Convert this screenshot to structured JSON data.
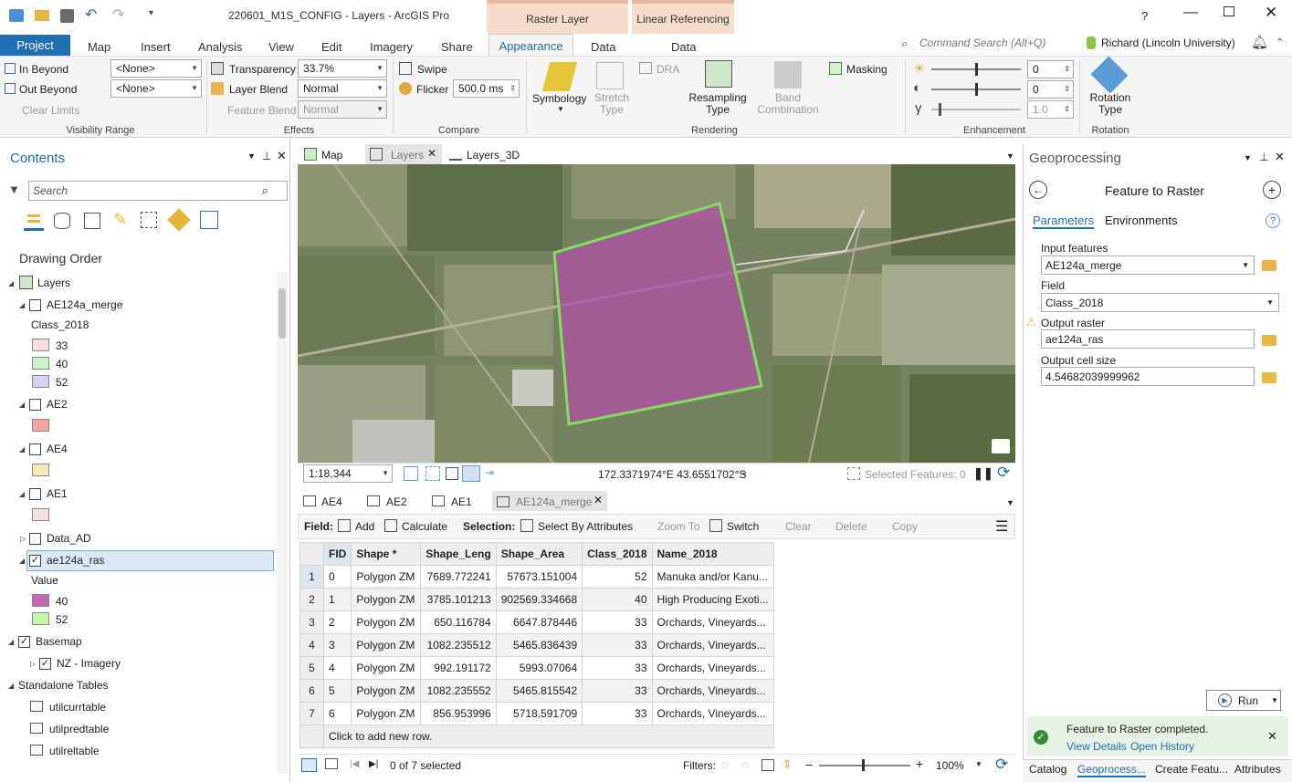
{
  "window": {
    "title": "220601_M1S_CONFIG - Layers - ArcGIS Pro",
    "help": "?",
    "context_tabs": [
      {
        "group": "Raster Layer",
        "tab": "Appearance"
      },
      {
        "group": "Linear Referencing",
        "tab": "Data"
      }
    ]
  },
  "ribbon_tabs": [
    "Project",
    "Map",
    "Insert",
    "Analysis",
    "View",
    "Edit",
    "Imagery",
    "Share",
    "Appearance",
    "Data"
  ],
  "command_search": "Command Search (Alt+Q)",
  "user": "Richard (Lincoln University)",
  "ribbon": {
    "visibility": {
      "in_beyond": "In Beyond",
      "out_beyond": "Out Beyond",
      "clear_limits": "Clear Limits",
      "in_value": "<None>",
      "out_value": "<None>",
      "group": "Visibility Range"
    },
    "effects": {
      "transparency_label": "Transparency",
      "transparency_value": "33.7%",
      "layer_blend_label": "Layer Blend",
      "layer_blend_value": "Normal",
      "feature_blend_label": "Feature Blend",
      "feature_blend_value": "Normal",
      "group": "Effects"
    },
    "compare": {
      "swipe": "Swipe",
      "flicker": "Flicker",
      "flicker_value": "500.0  ms",
      "group": "Compare"
    },
    "rendering": {
      "symbology": "Symbology",
      "stretch_type": "Stretch Type",
      "dra": "DRA",
      "resampling": "Resampling Type",
      "band_combination": "Band Combination",
      "masking": "Masking",
      "group": "Rendering"
    },
    "enhancement": {
      "values": [
        "0",
        "0",
        "1.0"
      ],
      "group": "Enhancement"
    },
    "rotation": {
      "label": "Rotation Type",
      "group": "Rotation"
    }
  },
  "contents": {
    "title": "Contents",
    "search_placeholder": "Search",
    "drawing_order": "Drawing Order",
    "layers_label": "Layers",
    "ae124a": "AE124a_merge",
    "class_field": "Class_2018",
    "classes": [
      "33",
      "40",
      "52"
    ],
    "ae2": "AE2",
    "ae4": "AE4",
    "ae1": "AE1",
    "data_ad": "Data_AD",
    "ae124a_ras": "ae124a_ras",
    "value_label": "Value",
    "ras_values": [
      "40",
      "52"
    ],
    "basemap": "Basemap",
    "nz_imagery": "NZ - Imagery",
    "standalone": "Standalone Tables",
    "tables": [
      "utilcurrtable",
      "utilpredtable",
      "utilreltable"
    ]
  },
  "views": {
    "tabs": [
      "Map",
      "Layers",
      "Layers_3D"
    ]
  },
  "map_status": {
    "scale": "1:18,344",
    "coords": "172.3371974°E 43.6551702°S",
    "selected_features": "Selected Features: 0"
  },
  "table_tabs": [
    "AE4",
    "AE2",
    "AE1",
    "AE124a_merge"
  ],
  "table_toolbar": {
    "field": "Field:",
    "add": "Add",
    "calculate": "Calculate",
    "selection": "Selection:",
    "select_by_attr": "Select By Attributes",
    "zoom_to": "Zoom To",
    "switch": "Switch",
    "clear": "Clear",
    "delete": "Delete",
    "copy": "Copy"
  },
  "table": {
    "headers": [
      "FID",
      "Shape *",
      "Shape_Leng",
      "Shape_Area",
      "Class_2018",
      "Name_2018"
    ],
    "rows": [
      [
        "1",
        "0",
        "Polygon ZM",
        "7689.772241",
        "57673.151004",
        "52",
        "Manuka and/or Kanu..."
      ],
      [
        "2",
        "1",
        "Polygon ZM",
        "3785.101213",
        "902569.334668",
        "40",
        "High Producing Exoti..."
      ],
      [
        "3",
        "2",
        "Polygon ZM",
        "650.116784",
        "6647.878446",
        "33",
        "Orchards, Vineyards..."
      ],
      [
        "4",
        "3",
        "Polygon ZM",
        "1082.235512",
        "5465.836439",
        "33",
        "Orchards, Vineyards..."
      ],
      [
        "5",
        "4",
        "Polygon ZM",
        "992.191172",
        "5993.07064",
        "33",
        "Orchards, Vineyards..."
      ],
      [
        "6",
        "5",
        "Polygon ZM",
        "1082.235552",
        "5465.815542",
        "33",
        "Orchards, Vineyards..."
      ],
      [
        "7",
        "6",
        "Polygon ZM",
        "856.953996",
        "5718.591709",
        "33",
        "Orchards, Vineyards..."
      ]
    ],
    "add_row": "Click to add new row.",
    "selected": "0 of 7 selected",
    "filters": "Filters:",
    "zoom": "100%"
  },
  "geoprocessing": {
    "title": "Geoprocessing",
    "tool": "Feature to Raster",
    "tab_params": "Parameters",
    "tab_env": "Environments",
    "input_label": "Input features",
    "input_value": "AE124a_merge",
    "field_label": "Field",
    "field_value": "Class_2018",
    "output_label": "Output raster",
    "output_value": "ae124a_ras",
    "cell_label": "Output cell size",
    "cell_value": "4.54682039999962",
    "run": "Run",
    "completed": "Feature to Raster completed.",
    "view_details": "View Details",
    "open_history": "Open History",
    "bottom_tabs": [
      "Catalog",
      "Geoprocess...",
      "Create Featu...",
      "Attributes"
    ]
  },
  "colors": {
    "accent": "#1f6fb2",
    "class33": "#f6dcdc",
    "class40": "#ccf2cc",
    "class52": "#d8d0f4",
    "ae2": "#f4a3a3",
    "ae4": "#f7e8b8",
    "ae1": "#f6e1d8",
    "ras40": "#c266b8",
    "ras52": "#c7f4a6"
  }
}
